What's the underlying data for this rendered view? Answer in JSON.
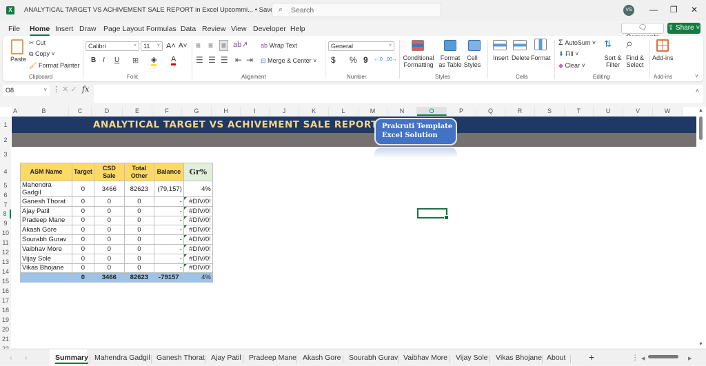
{
  "app": {
    "logo": "X",
    "doc_title": "ANALYTICAL TARGET VS ACHIVEMENT SALE REPORT in Excel Upcommi...  •  Saved to this PC",
    "search_placeholder": "Search",
    "search_icon": "search-icon",
    "user_initials": "VS",
    "window_controls": {
      "minimize": "—",
      "restore": "❐",
      "close": "✕"
    }
  },
  "menu": {
    "items": [
      "File",
      "Home",
      "Insert",
      "Draw",
      "Page Layout",
      "Formulas",
      "Data",
      "Review",
      "View",
      "Developer",
      "Help"
    ],
    "active": "Home",
    "comments_label": "Comments",
    "share_label": "Share"
  },
  "ribbon": {
    "clipboard": {
      "paste": "Paste",
      "cut": "Cut",
      "copy": "Copy",
      "format_painter": "Format Painter",
      "label": "Clipboard"
    },
    "font": {
      "name": "Calibri",
      "size": "11",
      "label": "Font",
      "bold": "B",
      "italic": "I",
      "underline": "U",
      "grow": "A˄",
      "shrink": "A˅",
      "font_color": "A"
    },
    "alignment": {
      "wrap_text": "Wrap Text",
      "merge_center": "Merge & Center",
      "label": "Alignment"
    },
    "number": {
      "format": "General",
      "currency": "$",
      "percent": "%",
      "comma": "9",
      "inc_decimal": "←.0",
      "dec_decimal": ".00→",
      "label": "Number"
    },
    "styles": {
      "conditional_formatting": "Conditional Formatting",
      "format_as_table": "Format as Table",
      "cell_styles": "Cell Styles",
      "label": "Styles"
    },
    "cells": {
      "insert": "Insert",
      "delete": "Delete",
      "format": "Format",
      "label": "Cells"
    },
    "editing": {
      "autosum": "AutoSum",
      "fill": "Fill",
      "clear": "Clear",
      "sort_filter": "Sort & Filter",
      "find_select": "Find & Select",
      "label": "Editing"
    },
    "addins": {
      "addins": "Add-ins",
      "label": "Add-ins"
    }
  },
  "formula_bar": {
    "name_box": "O8",
    "fx": "fx",
    "cancel": "✕",
    "enter": "✓",
    "value": ""
  },
  "columns": [
    "A",
    "B",
    "C",
    "D",
    "E",
    "F",
    "G",
    "H",
    "I",
    "J",
    "K",
    "L",
    "M",
    "N",
    "O",
    "P",
    "Q",
    "R",
    "S",
    "T",
    "U",
    "V",
    "W"
  ],
  "selected_column": "O",
  "rows": [
    "1",
    "2",
    "3",
    "4",
    "5",
    "6",
    "7",
    "8",
    "9",
    "10",
    "11",
    "12",
    "13",
    "14",
    "15",
    "16",
    "17",
    "18",
    "19",
    "20",
    "21",
    "22"
  ],
  "selected_row": "8",
  "sheet": {
    "title": "ANALYTICAL TARGET VS ACHIVEMENT SALE REPORT",
    "promo_line1": "Prakruti Template",
    "promo_line2": "Excel Solution",
    "table": {
      "headers": [
        "ASM Name",
        "Target",
        "CSD Sale",
        "Total Other",
        "Balance",
        "Gr%"
      ],
      "rows": [
        [
          "Mahendra Gadgil",
          "0",
          "3466",
          "82623",
          "(79,157)",
          "4%"
        ],
        [
          "Ganesh Thorat",
          "0",
          "0",
          "0",
          "-",
          "#DIV/0!"
        ],
        [
          "Ajay Patil",
          "0",
          "0",
          "0",
          "-",
          "#DIV/0!"
        ],
        [
          "Pradeep Mane",
          "0",
          "0",
          "0",
          "-",
          "#DIV/0!"
        ],
        [
          "Akash Gore",
          "0",
          "0",
          "0",
          "-",
          "#DIV/0!"
        ],
        [
          "Sourabh Gurav",
          "0",
          "0",
          "0",
          "-",
          "#DIV/0!"
        ],
        [
          "Vaibhav More",
          "0",
          "0",
          "0",
          "-",
          "#DIV/0!"
        ],
        [
          "Vijay Sole",
          "0",
          "0",
          "0",
          "-",
          "#DIV/0!"
        ],
        [
          "Vikas Bhojane",
          "0",
          "0",
          "0",
          "-",
          "#DIV/0!"
        ]
      ],
      "total": [
        "",
        "0",
        "3466",
        "82623",
        "-79157",
        "4%"
      ]
    },
    "colors": {
      "banner": "#1f3864",
      "banner_text": "#f4d58d",
      "subbanner": "#767171",
      "header_fill": "#ffd966",
      "gr_header_fill": "#e2efda",
      "total_fill": "#9dc3e6",
      "promo": "#4472c4",
      "accent": "#107c41"
    }
  },
  "tabs": {
    "items": [
      "Summary",
      "Mahendra Gadgil",
      "Ganesh Thorat",
      "Ajay Patil",
      "Pradeep Mane",
      "Akash Gore",
      "Sourabh Gurav",
      "Vaibhav More",
      "Vijay Sole",
      "Vikas Bhojane",
      "About"
    ],
    "active": "Summary",
    "add": "+"
  }
}
